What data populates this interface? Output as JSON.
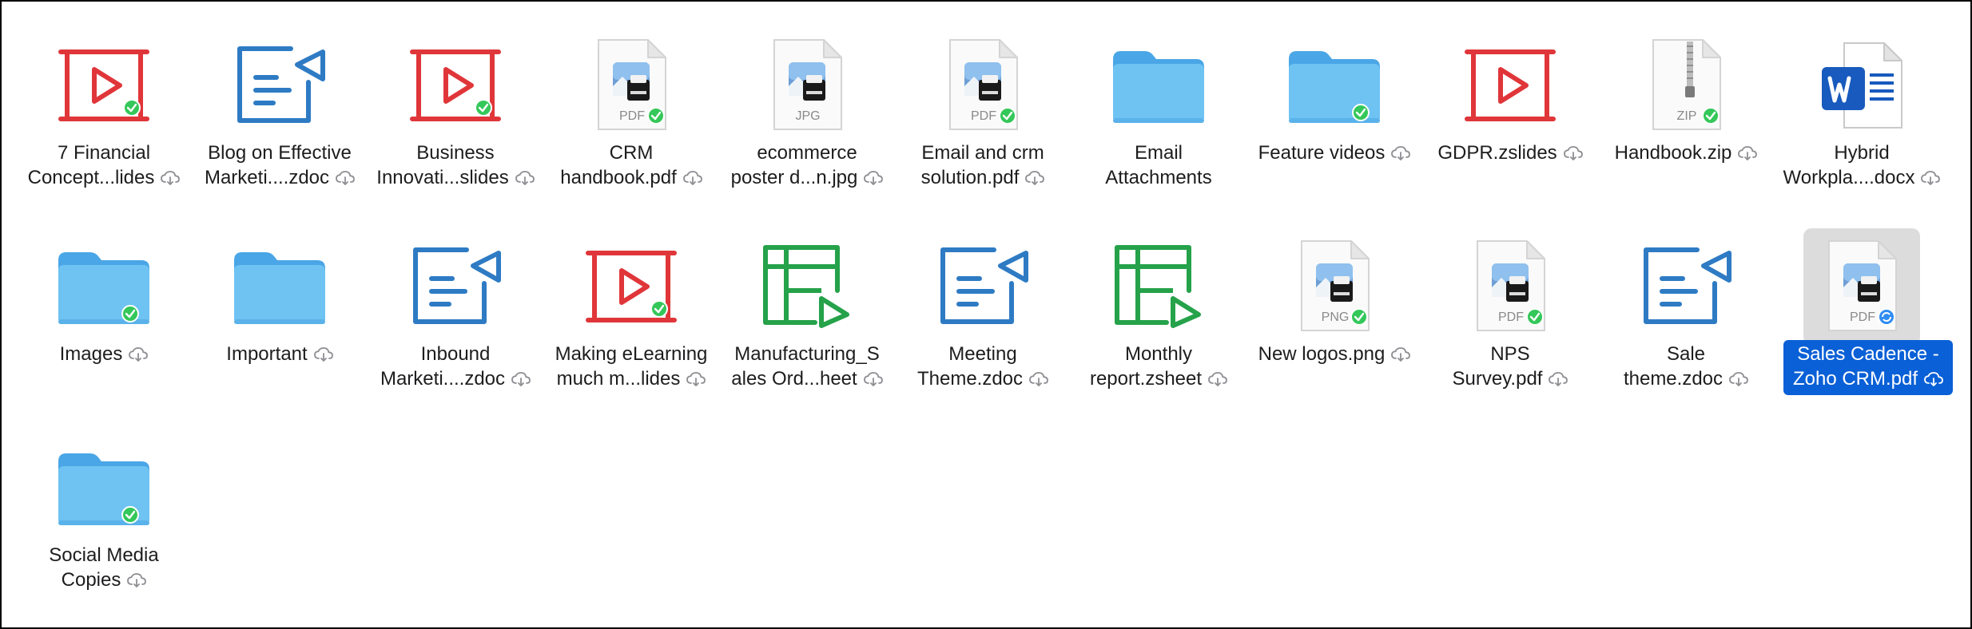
{
  "items": [
    {
      "type": "zslides",
      "lines": [
        "7 Financial",
        "Concept...lides"
      ],
      "cloud": true,
      "synced": true
    },
    {
      "type": "zdoc",
      "lines": [
        "Blog on Effective",
        "Marketi....zdoc"
      ],
      "cloud": true,
      "synced": false
    },
    {
      "type": "zslides",
      "lines": [
        "Business",
        "Innovati...slides"
      ],
      "cloud": true,
      "synced": true
    },
    {
      "type": "doc",
      "ext": "PDF",
      "lines": [
        "CRM",
        "handbook.pdf"
      ],
      "cloud": true,
      "synced": true
    },
    {
      "type": "doc",
      "ext": "JPG",
      "lines": [
        "ecommerce",
        "poster d...n.jpg"
      ],
      "cloud": true,
      "synced": false
    },
    {
      "type": "doc",
      "ext": "PDF",
      "lines": [
        "Email and crm",
        "solution.pdf"
      ],
      "cloud": true,
      "synced": true
    },
    {
      "type": "folder",
      "lines": [
        "Email",
        "Attachments"
      ],
      "cloud": false,
      "synced": false
    },
    {
      "type": "folder",
      "lines": [
        "Feature videos"
      ],
      "cloud": true,
      "synced": true
    },
    {
      "type": "zslides",
      "lines": [
        "GDPR.zslides"
      ],
      "cloud": true,
      "synced": false
    },
    {
      "type": "zip",
      "ext": "ZIP",
      "lines": [
        "Handbook.zip"
      ],
      "cloud": true,
      "synced": true
    },
    {
      "type": "word",
      "lines": [
        "Hybrid",
        "Workpla....docx"
      ],
      "cloud": true,
      "synced": false
    },
    {
      "type": "folder",
      "lines": [
        "Images"
      ],
      "cloud": true,
      "synced": true
    },
    {
      "type": "folder",
      "lines": [
        "Important"
      ],
      "cloud": true,
      "synced": false
    },
    {
      "type": "zdoc",
      "lines": [
        "Inbound",
        "Marketi....zdoc"
      ],
      "cloud": true,
      "synced": false
    },
    {
      "type": "zslides",
      "lines": [
        "Making eLearning",
        "much m...lides"
      ],
      "cloud": true,
      "synced": true
    },
    {
      "type": "zsheet",
      "lines": [
        "Manufacturing_S",
        "ales Ord...heet"
      ],
      "cloud": true,
      "synced": false
    },
    {
      "type": "zdoc",
      "lines": [
        "Meeting",
        "Theme.zdoc"
      ],
      "cloud": true,
      "synced": false
    },
    {
      "type": "zsheet",
      "lines": [
        "Monthly",
        "report.zsheet"
      ],
      "cloud": true,
      "synced": false
    },
    {
      "type": "doc",
      "ext": "PNG",
      "lines": [
        "New logos.png"
      ],
      "cloud": true,
      "synced": true
    },
    {
      "type": "doc",
      "ext": "PDF",
      "lines": [
        "NPS",
        "Survey.pdf"
      ],
      "cloud": true,
      "synced": true
    },
    {
      "type": "zdoc",
      "lines": [
        "Sale",
        "theme.zdoc"
      ],
      "cloud": true,
      "synced": false
    },
    {
      "type": "doc",
      "ext": "PDF",
      "lines": [
        "Sales Cadence -",
        "Zoho CRM.pdf"
      ],
      "cloud": true,
      "synced": false,
      "syncing": true,
      "selected": true
    },
    {
      "type": "folder",
      "lines": [
        "Social Media",
        "Copies"
      ],
      "cloud": true,
      "synced": true
    }
  ],
  "colors": {
    "selection": "#0a60d6",
    "synced_badge": "#34c759",
    "syncing_badge": "#2f8cf2",
    "zslides_red": "#e0363a",
    "zdoc_blue": "#2e7bc4",
    "zsheet_green": "#25a24a",
    "folder_blue": "#6ec3f2",
    "word_blue": "#185abd"
  }
}
